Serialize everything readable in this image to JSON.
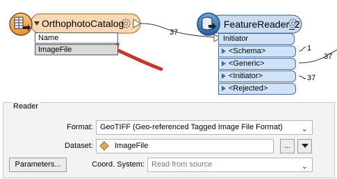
{
  "workspace": {
    "catalog_node": {
      "title": "OrthophotoCatalog",
      "attributes": [
        "Name",
        "ImageFile"
      ]
    },
    "reader_node": {
      "title": "FeatureReader_2",
      "input_port": "Initiator",
      "output_ports": [
        "<Schema>",
        "<Generic>",
        "<Initiator>",
        "<Rejected>"
      ],
      "counts": {
        "connection_in": "37",
        "schema": "1",
        "generic": "37",
        "initiator": "37"
      }
    }
  },
  "reader_panel": {
    "group_title": "Reader",
    "format_label": "Format:",
    "format_value": "GeoTIFF (Geo-referenced Tagged Image File Format)",
    "dataset_label": "Dataset:",
    "dataset_value": "ImageFile",
    "browse_label": "...",
    "parameters_label": "Parameters...",
    "coord_label": "Coord. System:",
    "coord_placeholder": "Read from source"
  },
  "colors": {
    "node_orange": "#f0a24a",
    "node_blue": "#2f6db0",
    "port_blue": "#cfe2f7",
    "arrow_red": "#c0392b"
  }
}
